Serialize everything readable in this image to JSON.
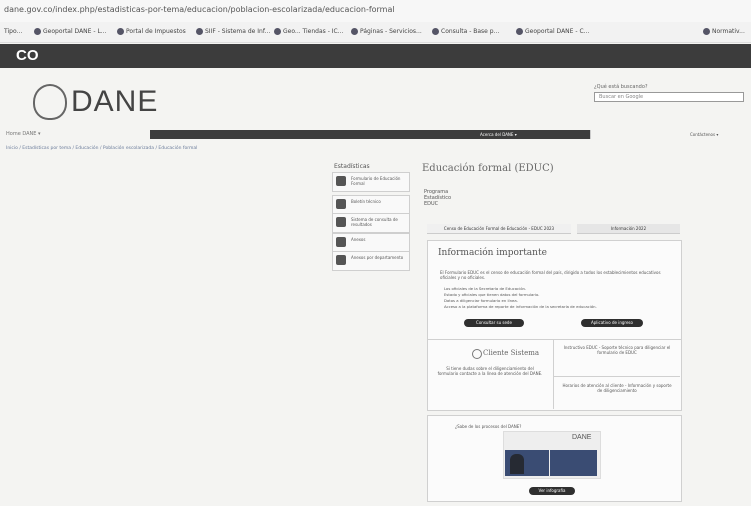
{
  "browser": {
    "url": "dane.gov.co/index.php/estadisticas-por-tema/educacion/poblacion-escolarizada/educacion-formal",
    "bookmarks": [
      {
        "label": "Tipo..."
      },
      {
        "label": "Geoportal DANE - L..."
      },
      {
        "label": "Portal de Impuestos"
      },
      {
        "label": "SIIF - Sistema de Inf..."
      },
      {
        "label": "Geo... Tiendas - IC..."
      },
      {
        "label": "Páginas - Servicios..."
      },
      {
        "label": "Consulta - Base p..."
      },
      {
        "label": "Geoportal DANE - C..."
      },
      {
        "label": "Normativ..."
      }
    ]
  },
  "gov_bar": {
    "label": "CO",
    "color": "#3c3c3c"
  },
  "header": {
    "logo_text": "DANE",
    "search_label": "¿Qué está buscando?",
    "search_placeholder": "Buscar en Google"
  },
  "nav": {
    "left_label": "Home DANE ▾",
    "items": [
      "Acerca del DANE ▾",
      "Contáctenos ▾"
    ]
  },
  "breadcrumb": "Inicio / Estadísticas por tema / Educación / Población escolarizada / Educación formal",
  "sidebar": {
    "title": "Estadísticas",
    "items": [
      {
        "label": "Formulario de Educación Formal"
      },
      {
        "label": "Boletín técnico"
      },
      {
        "label": "Sistema de consulta de resultados"
      },
      {
        "label": "Anexos"
      },
      {
        "label": "Anexos por departamento"
      }
    ]
  },
  "main": {
    "title": "Educación formal (EDUC)",
    "badge": "Programa Estadístico EDUC",
    "tabs": [
      "Censo de Educación Formal de Educación - EDUC 2023",
      "Información 2022"
    ],
    "info": {
      "heading": "Información importante",
      "intro": "El Formulario EDUC es el censo de educación formal del país, dirigido a todos los establecimientos educativos oficiales y no oficiales.",
      "bullets": [
        "Los oficiales de la Secretaría de Educación.",
        "Estado y oficiales que tienen datos del formulario.",
        "Datos a diligenciar formulario en línea.",
        "Acceso a la plataforma de reporte de información de la secretaría de educación."
      ],
      "buttons": [
        "Consultar su sede",
        "Aplicativo de ingreso"
      ]
    },
    "cliente": {
      "label": "Cliente Sistema",
      "text": "Si tiene dudas sobre el diligenciamiento del formulario contacte a la línea de atención del DANE.",
      "links": [
        "Instructivo EDUC - Soporte técnico para diligenciar el formulario de EDUC",
        "Horarios de atención al cliente - Información y soporte de diligenciamiento"
      ]
    },
    "ad": {
      "caption": "¿Sabe de los procesos del DANE?",
      "brand": "DANE",
      "button": "Ver infografía"
    }
  }
}
